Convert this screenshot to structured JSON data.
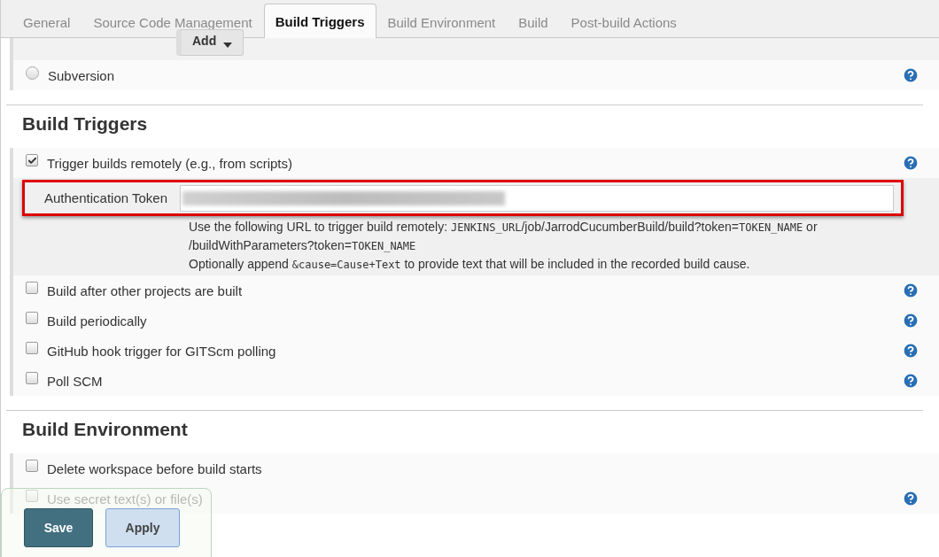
{
  "tabs": [
    {
      "label": "General",
      "selected": false
    },
    {
      "label": "Source Code Management",
      "selected": false
    },
    {
      "label": "Build Triggers",
      "selected": true
    },
    {
      "label": "Build Environment",
      "selected": false
    },
    {
      "label": "Build",
      "selected": false
    },
    {
      "label": "Post-build Actions",
      "selected": false
    }
  ],
  "scm": {
    "add_button": "Add",
    "subversion": {
      "label": "Subversion",
      "selected": false
    }
  },
  "build_triggers": {
    "title": "Build Triggers",
    "items": [
      {
        "label": "Trigger builds remotely (e.g., from scripts)",
        "checked": true,
        "token": {
          "label": "Authentication Token",
          "highlighted": true
        },
        "help_lines": [
          [
            {
              "text": "Use the following URL to trigger build remotely: ",
              "kind": "text"
            },
            {
              "text": "JENKINS_URL",
              "kind": "code"
            },
            {
              "text": "/job/JarrodCucumberBuild/build?token=",
              "kind": "text"
            },
            {
              "text": "TOKEN_NAME",
              "kind": "code"
            },
            {
              "text": " or",
              "kind": "text"
            }
          ],
          [
            {
              "text": "/buildWithParameters?token=",
              "kind": "text"
            },
            {
              "text": "TOKEN_NAME",
              "kind": "code"
            }
          ],
          [
            {
              "text": "Optionally append ",
              "kind": "text"
            },
            {
              "text": "&cause=Cause+Text",
              "kind": "code"
            },
            {
              "text": " to provide text that will be included in the recorded build cause.",
              "kind": "text"
            }
          ]
        ]
      },
      {
        "label": "Build after other projects are built",
        "checked": false
      },
      {
        "label": "Build periodically",
        "checked": false
      },
      {
        "label": "GitHub hook trigger for GITScm polling",
        "checked": false
      },
      {
        "label": "Poll SCM",
        "checked": false
      }
    ]
  },
  "build_environment": {
    "title": "Build Environment",
    "items": [
      {
        "label": "Delete workspace before build starts",
        "checked": false,
        "help": false
      },
      {
        "label": "Use secret text(s) or file(s)",
        "checked": false,
        "help": true
      }
    ]
  },
  "footer": {
    "save": "Save",
    "apply": "Apply"
  }
}
